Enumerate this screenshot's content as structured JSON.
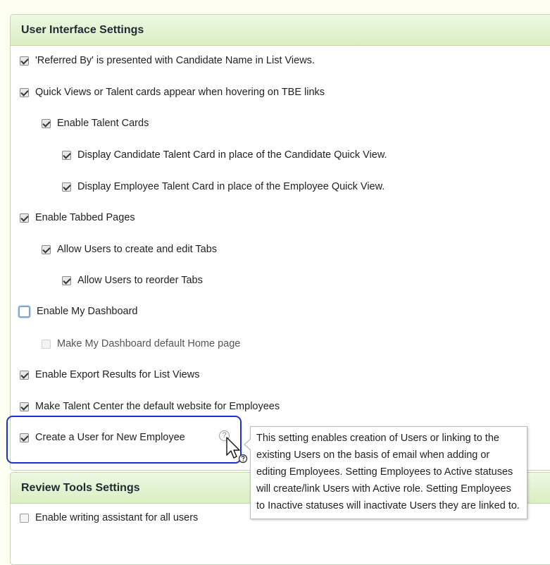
{
  "ui_settings": {
    "title": "User Interface Settings",
    "options": [
      {
        "label": "'Referred By' is presented with Candidate Name in List Views.",
        "checked": true
      },
      {
        "label": "Quick Views or Talent cards appear when hovering on TBE links",
        "checked": true
      },
      {
        "label": "Enable Talent Cards",
        "checked": true
      },
      {
        "label": "Display Candidate Talent Card in place of the Candidate Quick View.",
        "checked": true
      },
      {
        "label": "Display Employee Talent Card in place of the Employee Quick View.",
        "checked": true
      },
      {
        "label": "Enable Tabbed Pages",
        "checked": true
      },
      {
        "label": "Allow Users to create and edit Tabs",
        "checked": true
      },
      {
        "label": "Allow Users to reorder Tabs",
        "checked": true
      },
      {
        "label": "Enable My Dashboard",
        "checked": false
      },
      {
        "label": "Make My Dashboard default Home page",
        "checked": false,
        "disabled": true
      },
      {
        "label": "Enable Export Results for List Views",
        "checked": true
      },
      {
        "label": "Make Talent Center the default website for Employees",
        "checked": true
      },
      {
        "label": "Create a User for New Employee",
        "checked": true
      }
    ],
    "help_icon_glyph": "?"
  },
  "tooltip": {
    "text": "This setting enables creation of Users or linking to the existing Users on the basis of email when adding or editing Employees. Setting Employees to Active statuses will create/link Users with Active role. Setting Employees to Inactive statuses will inactivate Users they are linked to."
  },
  "review_tools": {
    "title": "Review Tools Settings",
    "options": [
      {
        "label": "Enable writing assistant for all users",
        "checked": false
      }
    ]
  },
  "colors": {
    "header_gradient_top": "#eef8e2",
    "header_gradient_bottom": "#d9efc3",
    "highlight_border": "#1d2fd6",
    "page_background": "#fefdf2"
  }
}
